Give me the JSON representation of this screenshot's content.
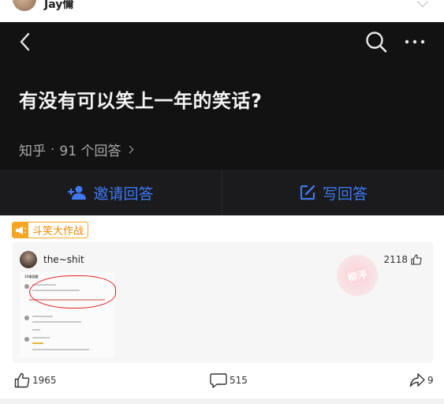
{
  "top_user": {
    "name": "Jay儞"
  },
  "question": {
    "title": "有没有可以笑上一年的笑话?",
    "source": "知乎",
    "dot": "·",
    "answer_count": "91 个回答"
  },
  "actions": {
    "invite_label": "邀请回答",
    "write_label": "写回答"
  },
  "badge": {
    "label": "斗笑大作战"
  },
  "answer": {
    "author": "the~shit",
    "likes": "2118",
    "stamp_text": "柳泙"
  },
  "bottom_bar": {
    "likes": "1965",
    "comments": "515",
    "shares": "9"
  },
  "colors": {
    "accent_blue": "#3f78f2",
    "badge_orange": "#f7a623",
    "dark_bg": "#121212"
  }
}
